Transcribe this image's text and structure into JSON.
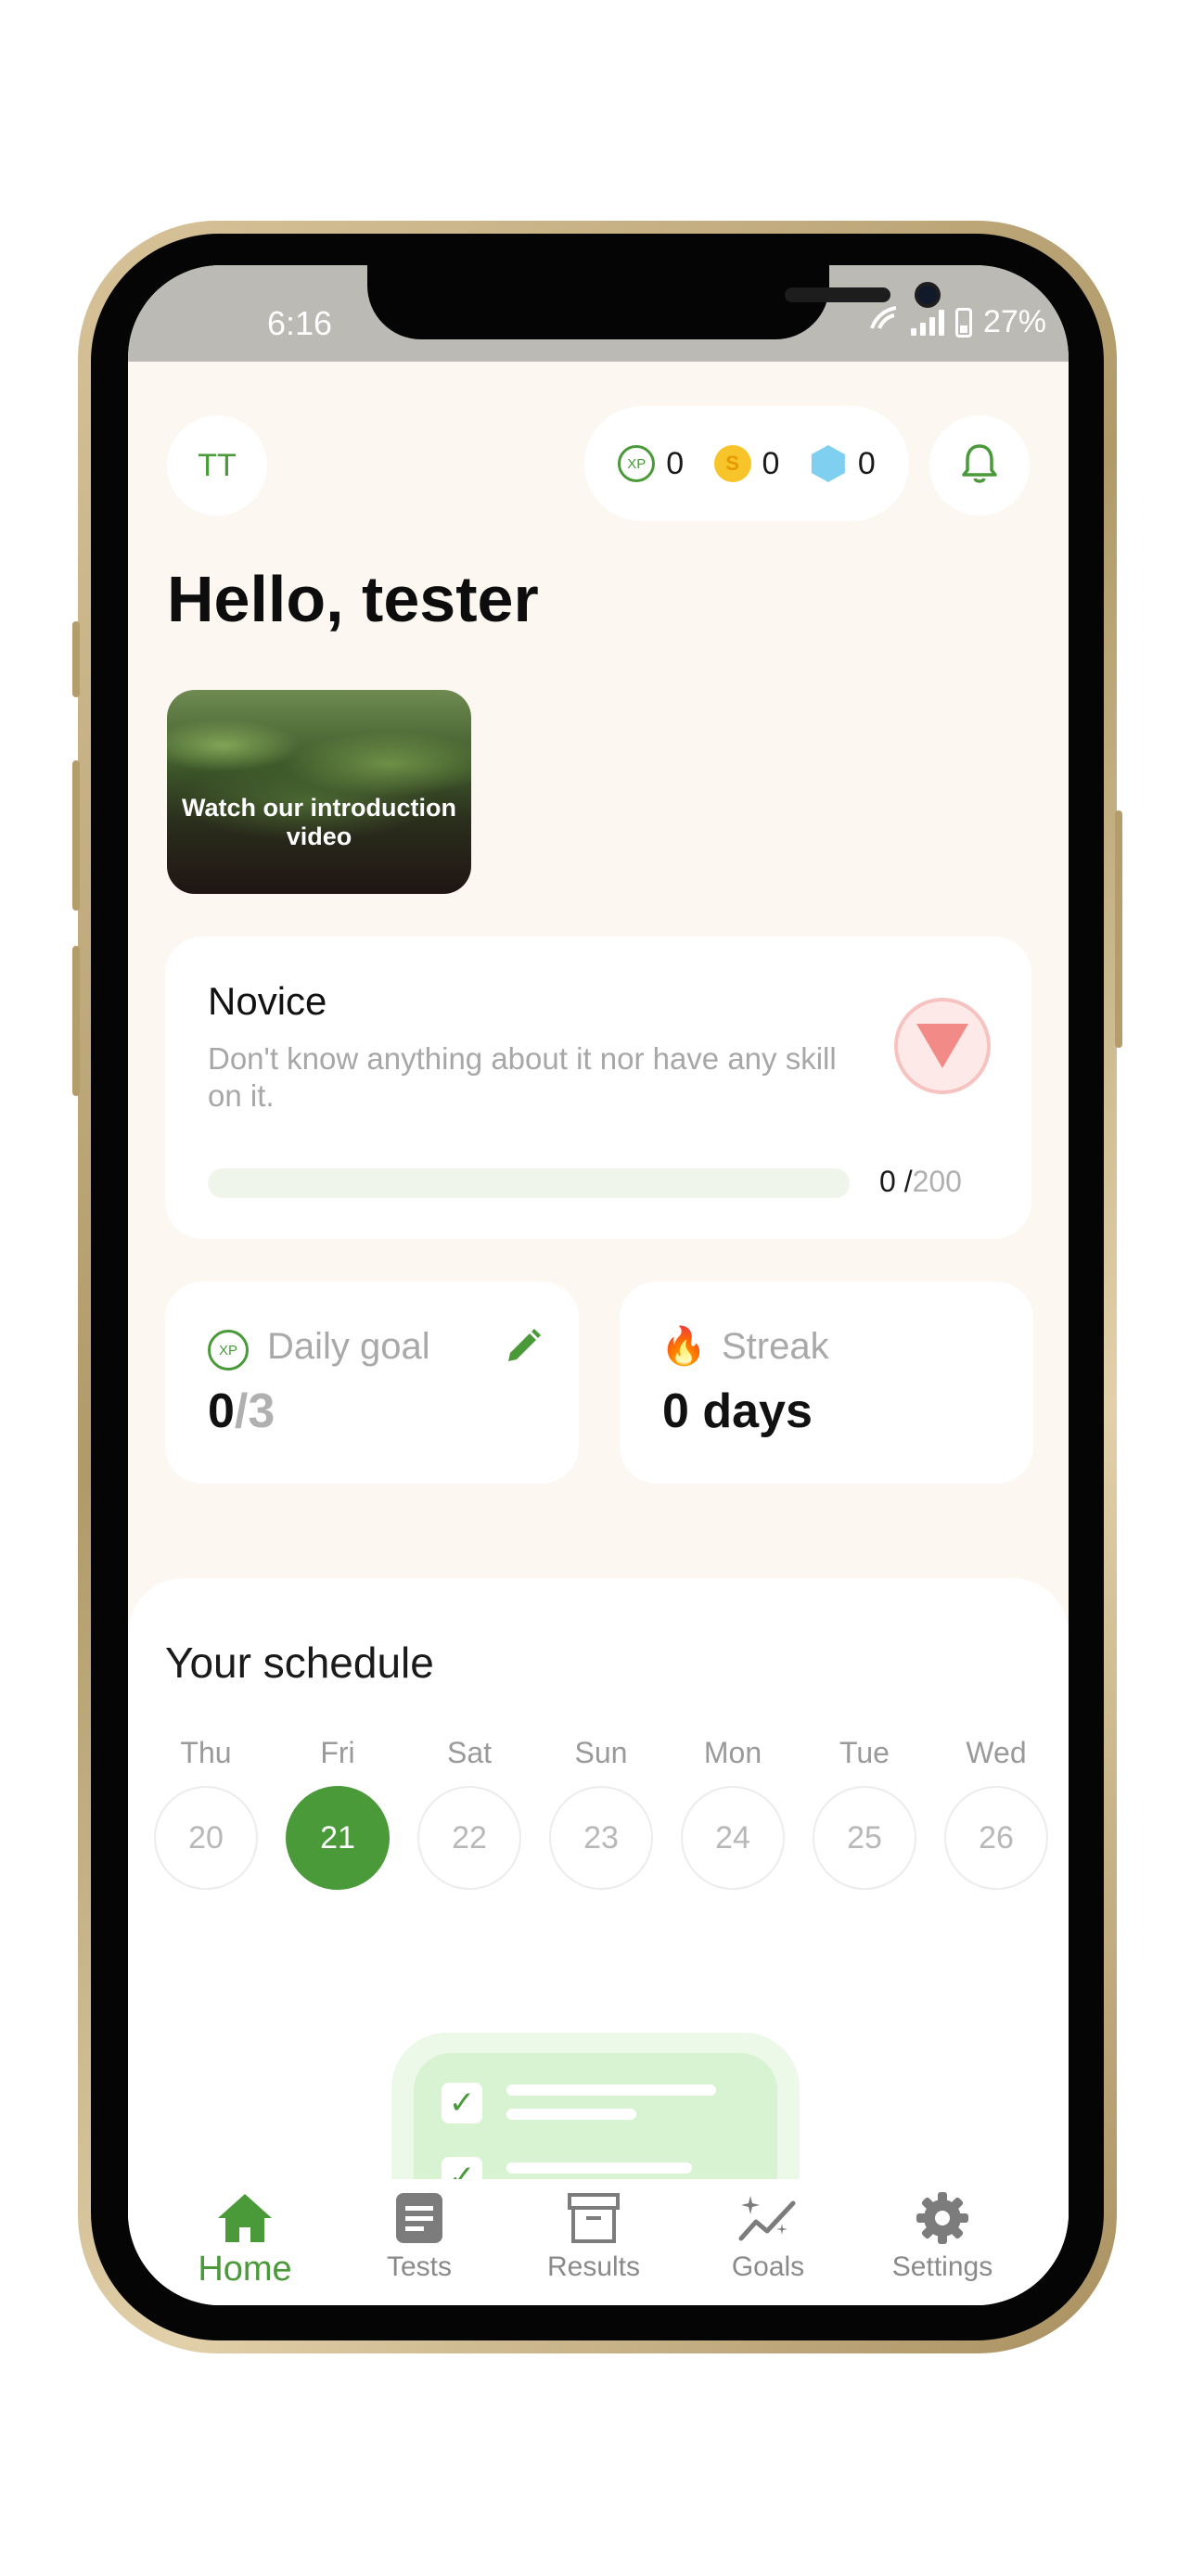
{
  "status_bar": {
    "time": "6:16",
    "battery": "27%"
  },
  "header": {
    "avatar_initials": "TT",
    "xp_label": "XP",
    "xp": "0",
    "coins_symbol": "S",
    "coins": "0",
    "gems": "0"
  },
  "greeting": "Hello, tester",
  "video": {
    "label": "Watch our introduction video"
  },
  "level": {
    "title": "Novice",
    "description": "Don't know anything about it nor have any skill on it.",
    "progress_current": "0",
    "progress_separator": " /",
    "progress_total": "200",
    "progress_fraction": 0
  },
  "daily_goal": {
    "label": "Daily goal",
    "value": "0",
    "target": "/3"
  },
  "streak": {
    "label": "Streak",
    "value": "0 days"
  },
  "schedule": {
    "title": "Your schedule",
    "days": [
      {
        "name": "Thu",
        "date": "20",
        "active": false
      },
      {
        "name": "Fri",
        "date": "21",
        "active": true
      },
      {
        "name": "Sat",
        "date": "22",
        "active": false
      },
      {
        "name": "Sun",
        "date": "23",
        "active": false
      },
      {
        "name": "Mon",
        "date": "24",
        "active": false
      },
      {
        "name": "Tue",
        "date": "25",
        "active": false
      },
      {
        "name": "Wed",
        "date": "26",
        "active": false
      }
    ]
  },
  "nav": {
    "home": "Home",
    "tests": "Tests",
    "results": "Results",
    "goals": "Goals",
    "settings": "Settings"
  },
  "colors": {
    "accent": "#4a9a3a",
    "background": "#fcf7f1",
    "muted_text": "#a7a7a7"
  }
}
